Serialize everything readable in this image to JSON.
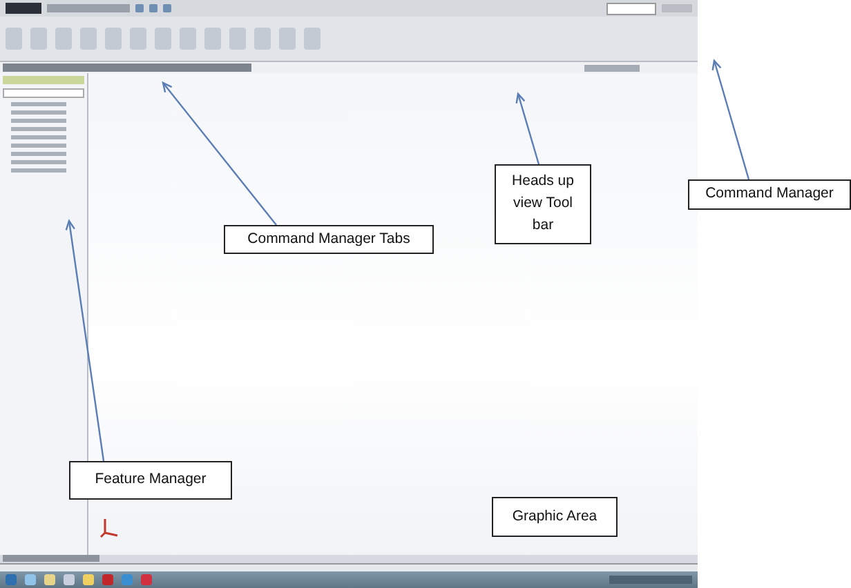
{
  "callouts": [
    {
      "label": "Command Manager Tabs"
    },
    {
      "label": "Heads up view Tool bar"
    },
    {
      "label": "Command Manager"
    },
    {
      "label": "Feature Manager"
    },
    {
      "label": "Graphic Area"
    }
  ]
}
